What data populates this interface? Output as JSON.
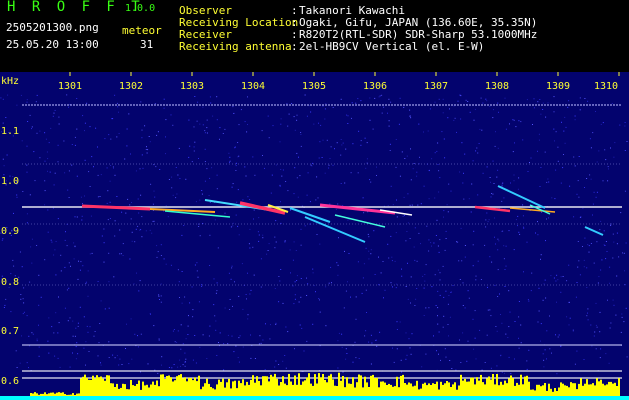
{
  "header": {
    "logo": "H R O F F T",
    "version": "1.0.0",
    "filename": "2505201300.png",
    "datetime": "25.05.20 13:00",
    "meteor_label": "meteor",
    "meteor_count": "31",
    "info": [
      {
        "label": "Observer",
        "sep": ":",
        "value": "Takanori Kawachi"
      },
      {
        "label": "Receiving Location",
        "sep": ":",
        "value": "Ogaki, Gifu, JAPAN (136.60E, 35.35N)"
      },
      {
        "label": "Receiver",
        "sep": ":",
        "value": "R820T2(RTL-SDR) SDR-Sharp 53.1000MHz"
      },
      {
        "label": "Receiving antenna",
        "sep": ":",
        "value": "2el-HB9CV Vertical (el. E-W)"
      }
    ]
  },
  "plot": {
    "y_unit": "kHz",
    "y_ticks": [
      "1.1",
      "1.0",
      "0.9",
      "0.8",
      "0.7",
      "0.6"
    ],
    "x_ticks": [
      "1301",
      "1302",
      "1303",
      "1304",
      "1305",
      "1306",
      "1307",
      "1308",
      "1309",
      "1310"
    ],
    "colors": {
      "background": "#03036e",
      "axis_text": "#ffff33",
      "signal_peak": "#ff2a55",
      "level_bar": "#ffff00"
    }
  }
}
